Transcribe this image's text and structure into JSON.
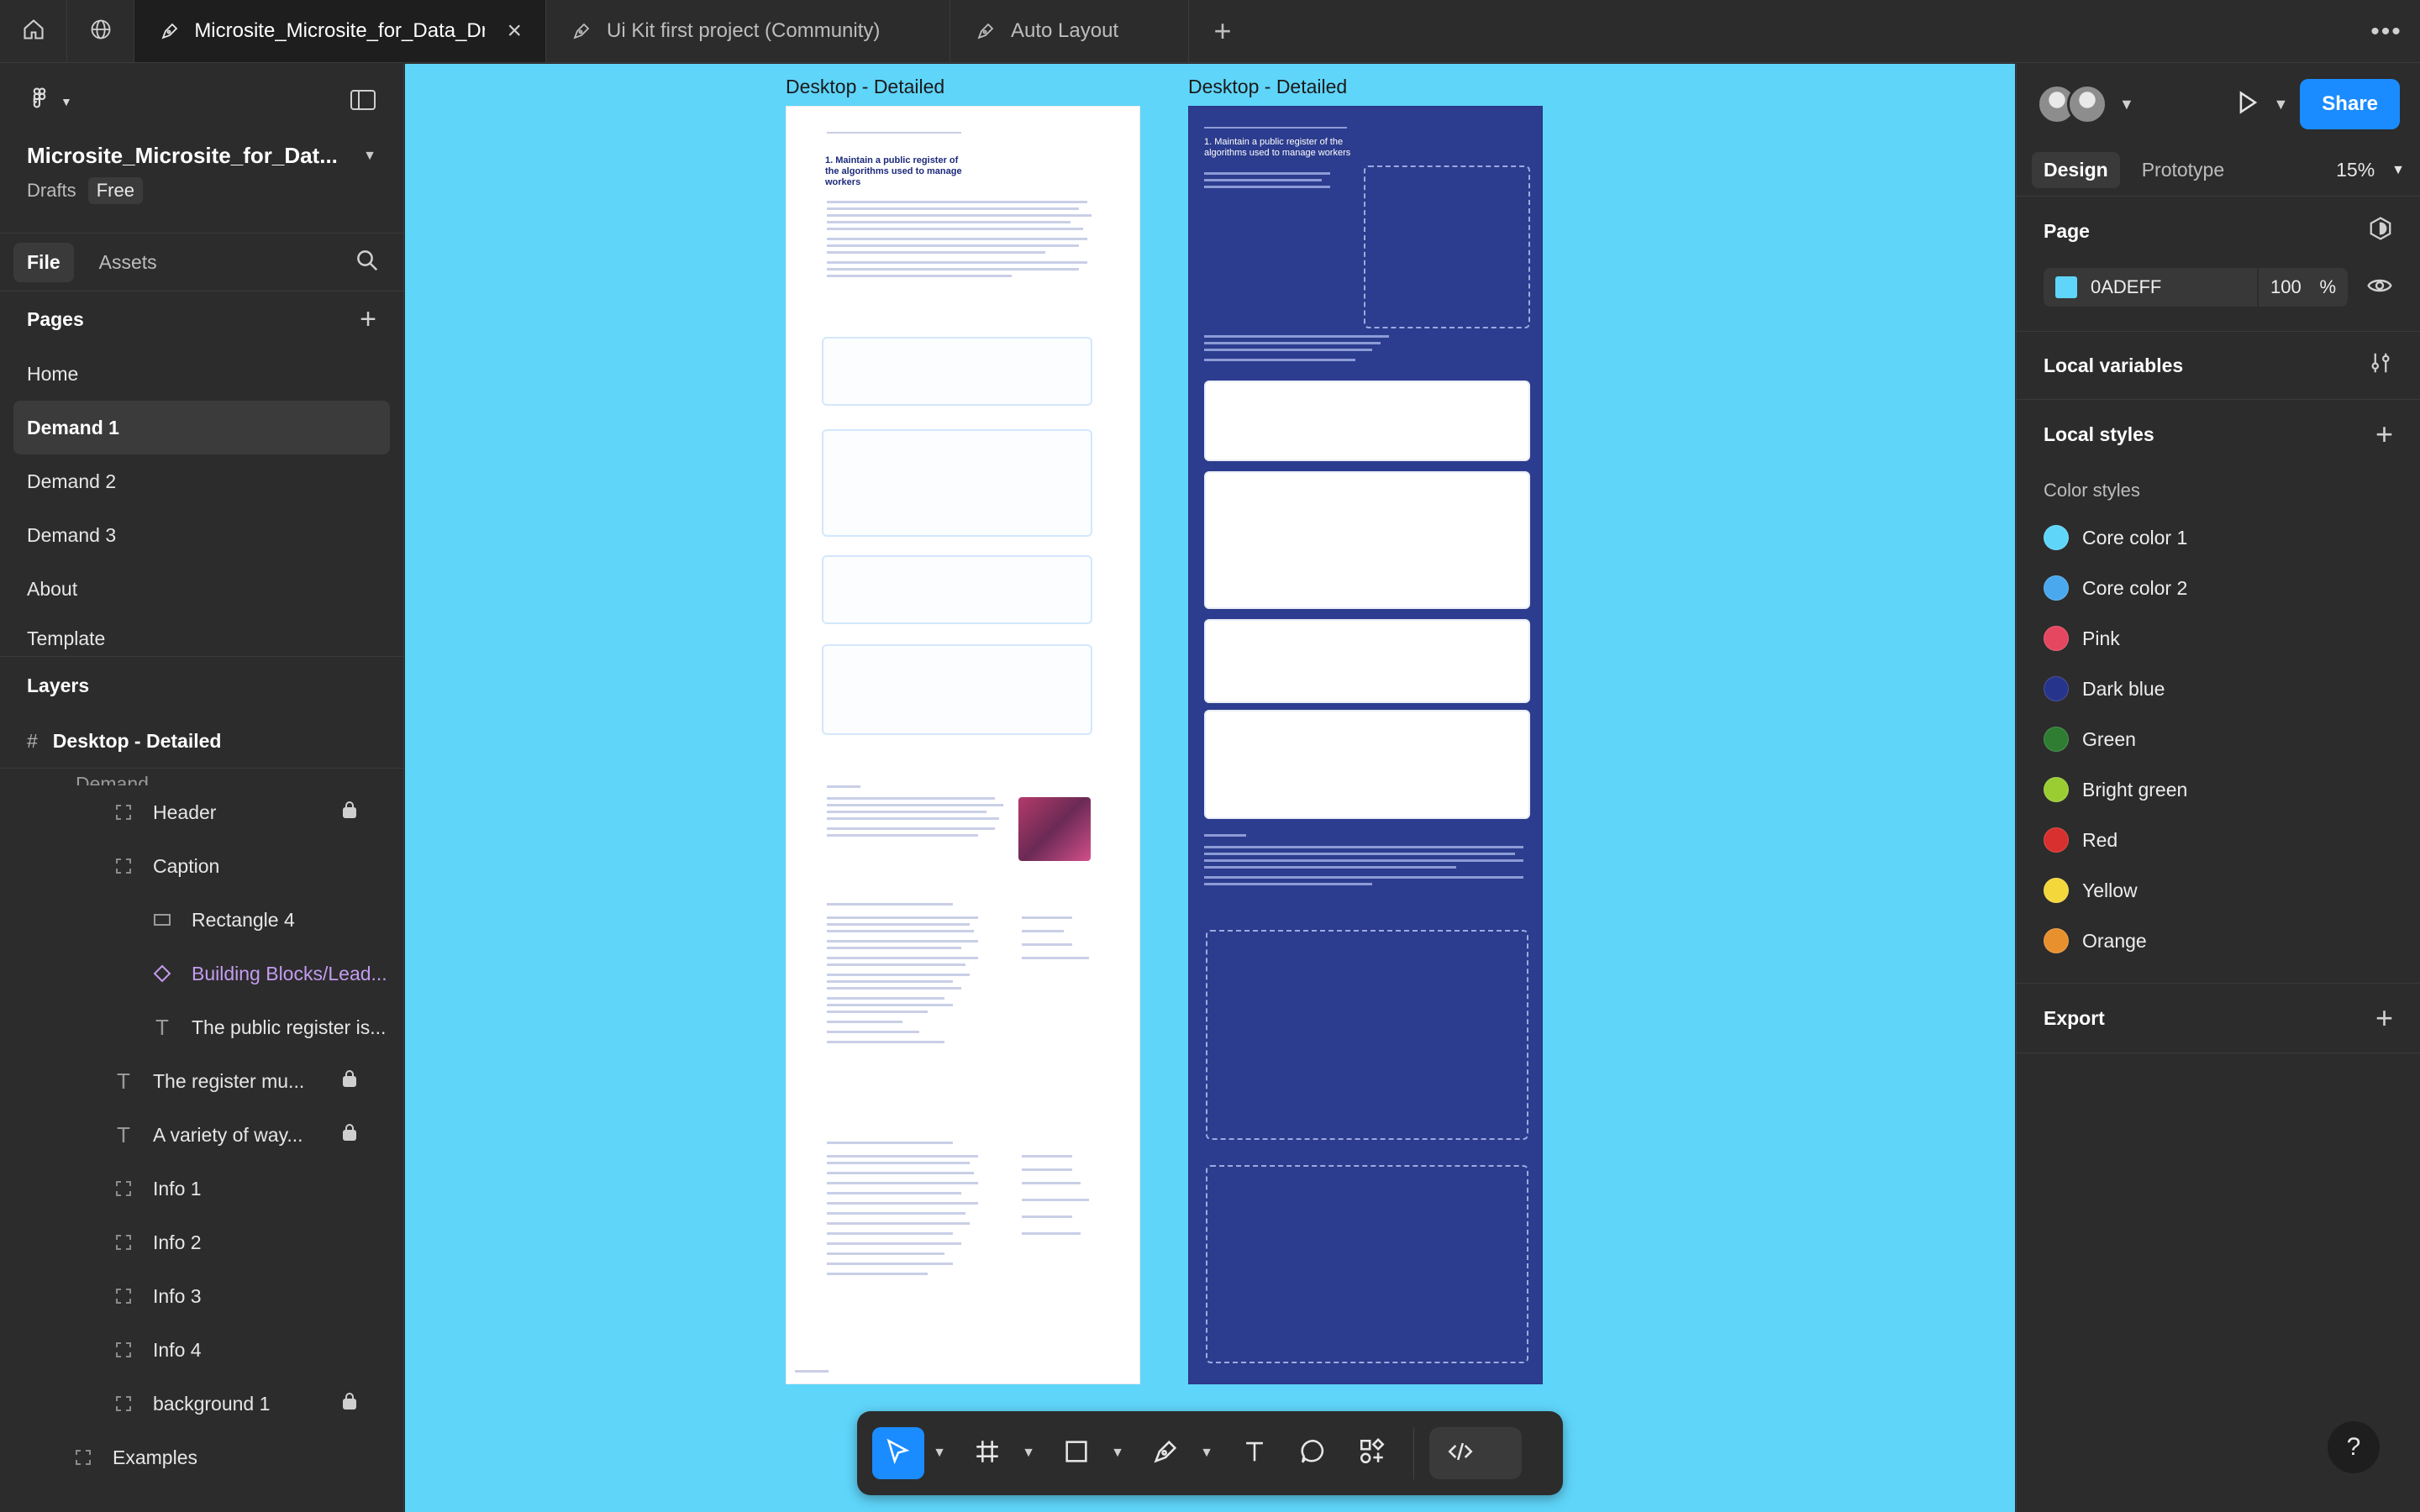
{
  "tabs": [
    {
      "label": "Microsite_Microsite_for_Data_Dri",
      "active": true
    },
    {
      "label": "Ui Kit first project (Community)",
      "active": false
    },
    {
      "label": "Auto Layout",
      "active": false
    }
  ],
  "file": {
    "title": "Microsite_Microsite_for_Dat...",
    "location": "Drafts",
    "plan": "Free"
  },
  "left_tabs": {
    "file": "File",
    "assets": "Assets"
  },
  "pages": {
    "heading": "Pages",
    "items": [
      "Home",
      "Demand 1",
      "Demand 2",
      "Demand 3",
      "About",
      "Template"
    ],
    "active_index": 1
  },
  "layers": {
    "heading": "Layers",
    "frame": "Desktop - Detailed",
    "partial": "Demand",
    "items": [
      {
        "label": "Header",
        "icon": "frame-dashed-icon",
        "indent": 1,
        "locked": true
      },
      {
        "label": "Caption",
        "icon": "frame-dashed-icon",
        "indent": 1,
        "locked": false
      },
      {
        "label": "Rectangle 4",
        "icon": "rectangle-icon",
        "indent": 2,
        "locked": false
      },
      {
        "label": "Building Blocks/Lead...",
        "icon": "component-diamond-icon",
        "indent": 2,
        "locked": false,
        "component": true
      },
      {
        "label": "The public register is...",
        "icon": "text-icon",
        "indent": 2,
        "locked": false
      },
      {
        "label": "The register mu...",
        "icon": "text-icon",
        "indent": 1,
        "locked": true
      },
      {
        "label": "A variety of way...",
        "icon": "text-icon",
        "indent": 1,
        "locked": true
      },
      {
        "label": "Info 1",
        "icon": "frame-dashed-icon",
        "indent": 1,
        "locked": false
      },
      {
        "label": "Info 2",
        "icon": "frame-dashed-icon",
        "indent": 1,
        "locked": false
      },
      {
        "label": "Info 3",
        "icon": "frame-dashed-icon",
        "indent": 1,
        "locked": false
      },
      {
        "label": "Info 4",
        "icon": "frame-dashed-icon",
        "indent": 1,
        "locked": false
      },
      {
        "label": "background 1",
        "icon": "frame-dashed-icon",
        "indent": 1,
        "locked": true
      },
      {
        "label": "Examples",
        "icon": "frame-dashed-icon",
        "indent": 0,
        "locked": false
      }
    ]
  },
  "canvas": {
    "background": "#5fd5fa",
    "frames": [
      {
        "label": "Desktop - Detailed",
        "theme": "white",
        "heading": "1. Maintain a public register of the algorithms used to manage workers"
      },
      {
        "label": "Desktop - Detailed",
        "theme": "dark",
        "heading": "1. Maintain a public register of the algorithms used to manage workers"
      }
    ]
  },
  "toolbar": {
    "tools": [
      "move-tool",
      "frame-tool",
      "shape-tool",
      "pen-tool",
      "text-tool",
      "comment-tool",
      "actions-tool",
      "dev-mode-toggle"
    ]
  },
  "right": {
    "share": "Share",
    "tabs": {
      "design": "Design",
      "prototype": "Prototype"
    },
    "zoom": "15%",
    "page_section": "Page",
    "page_color": {
      "hex": "0ADEFF",
      "opacity": "100",
      "unit": "%"
    },
    "local_variables": "Local variables",
    "local_styles": "Local styles",
    "color_styles_heading": "Color styles",
    "color_styles": [
      {
        "name": "Core color 1",
        "color": "#5fd5fa"
      },
      {
        "name": "Core color 2",
        "color": "#4aa8ee"
      },
      {
        "name": "Pink",
        "color": "#e54660"
      },
      {
        "name": "Dark blue",
        "color": "#27348b"
      },
      {
        "name": "Green",
        "color": "#2e7d32"
      },
      {
        "name": "Bright green",
        "color": "#9acd32"
      },
      {
        "name": "Red",
        "color": "#d8302e"
      },
      {
        "name": "Yellow",
        "color": "#f4d73b"
      },
      {
        "name": "Orange",
        "color": "#e8902e"
      }
    ],
    "export": "Export"
  },
  "help": "?"
}
